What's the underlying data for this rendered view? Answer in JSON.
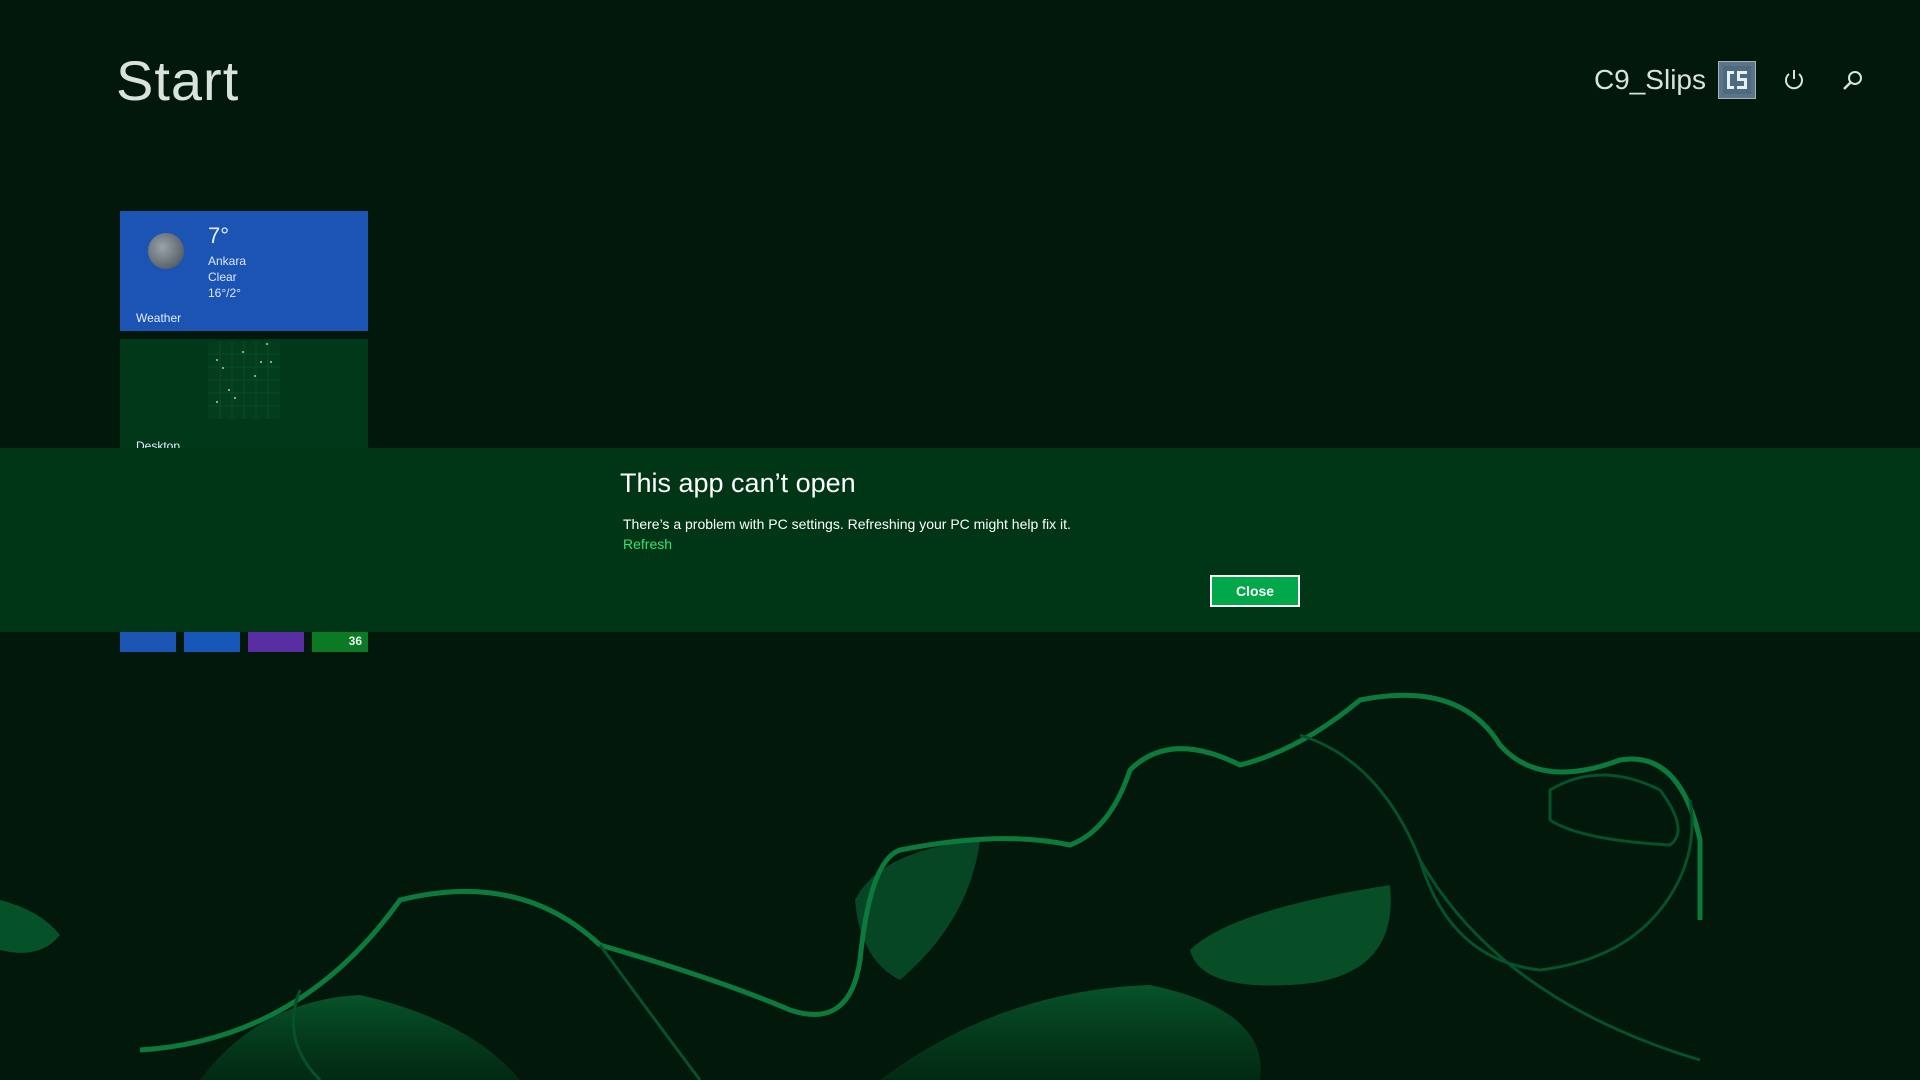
{
  "start": {
    "title": "Start"
  },
  "user": {
    "name": "C9_Slips"
  },
  "icons": {
    "avatar": "avatar-icon",
    "power": "power-icon",
    "search": "search-icon",
    "weather": "moon-icon"
  },
  "tiles": {
    "weather": {
      "temp": "7°",
      "city": "Ankara",
      "condition": "Clear",
      "range": "16°/2°",
      "label": "Weather",
      "color": "#1c54b4"
    },
    "desktop": {
      "label": "Desktop",
      "color": "#02381a"
    },
    "small": [
      {
        "color": "#1b54b3"
      },
      {
        "color": "#1656b9"
      },
      {
        "color": "#5a2ea3"
      },
      {
        "color": "#0c7a25",
        "count": "36"
      }
    ]
  },
  "dialog": {
    "title": "This app can’t open",
    "message": "There’s a problem with PC settings. Refreshing your PC might help fix it.",
    "link": "Refresh",
    "close_label": "Close",
    "band_color": "#003515",
    "button_color": "#00a84a",
    "link_color": "#37e07a"
  },
  "theme": {
    "background": "#01180b",
    "accent": "#0a7a3a"
  }
}
